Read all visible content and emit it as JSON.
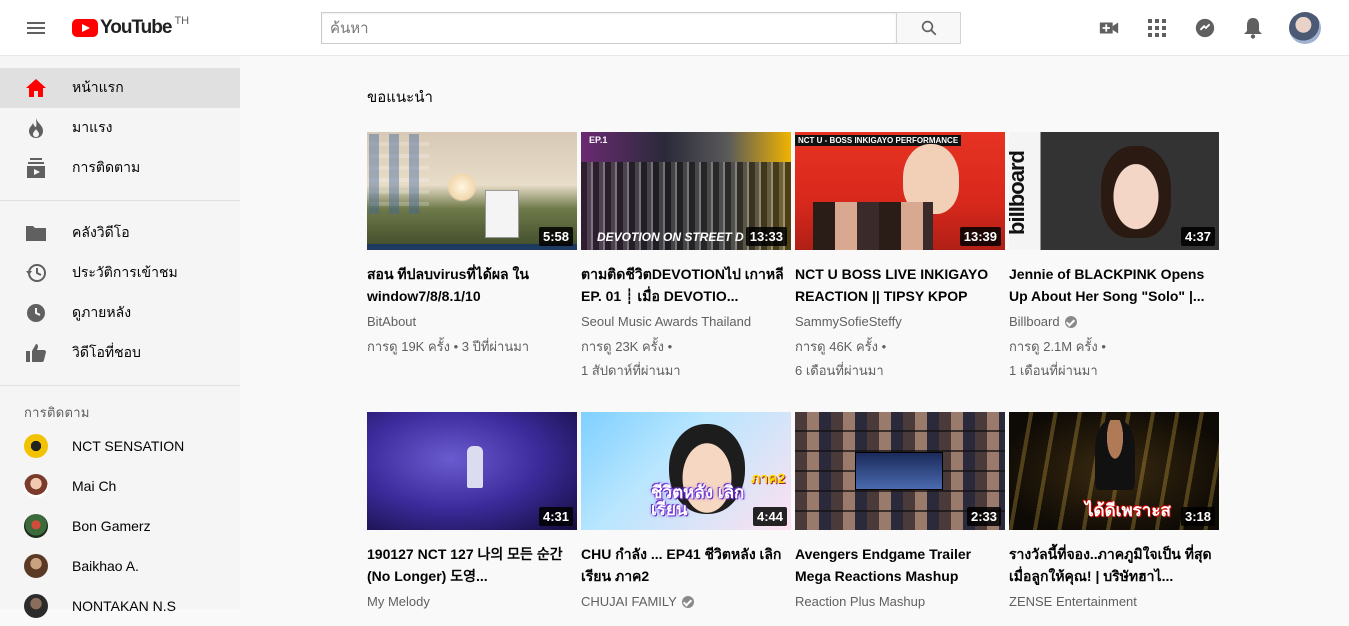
{
  "header": {
    "logo_text": "YouTube",
    "logo_country": "TH",
    "search_placeholder": "ค้นหา"
  },
  "sidebar": {
    "primary": [
      {
        "label": "หน้าแรก",
        "icon": "home-icon",
        "active": true
      },
      {
        "label": "มาแรง",
        "icon": "fire-icon",
        "active": false
      },
      {
        "label": "การติดตาม",
        "icon": "subscriptions-icon",
        "active": false
      }
    ],
    "library": [
      {
        "label": "คลังวิดีโอ",
        "icon": "folder-icon"
      },
      {
        "label": "ประวัติการเข้าชม",
        "icon": "history-icon"
      },
      {
        "label": "ดูภายหลัง",
        "icon": "clock-icon"
      },
      {
        "label": "วิดีโอที่ชอบ",
        "icon": "thumbs-up-icon"
      }
    ],
    "subscriptions_heading": "การติดตาม",
    "subscriptions": [
      {
        "label": "NCT SENSATION"
      },
      {
        "label": "Mai Ch"
      },
      {
        "label": "Bon Gamerz"
      },
      {
        "label": "Baikhao A."
      },
      {
        "label": "NONTAKAN N.S"
      }
    ]
  },
  "main": {
    "section_title": "ขอแนะนำ",
    "videos": [
      {
        "title": "สอน ทีปลบvirusที่ได้ผล ใน window7/8/8.1/10",
        "channel": "BitAbout",
        "verified": false,
        "views": "การดู 19K ครั้ง",
        "age": "3 ปีที่ผ่านมา",
        "duration": "5:58"
      },
      {
        "title": "ตามติดชีวิตDEVOTIONไป เกาหลี EP. 01 ┊ เมื่อ DEVOTIO...",
        "channel": "Seoul Music Awards Thailand",
        "verified": false,
        "views": "การดู 23K ครั้ง",
        "age": "1 สัปดาห์ที่ผ่านมา",
        "duration": "13:33",
        "thumb_text": "DEVOTION ON STREET D",
        "thumb_badge": "EP.1"
      },
      {
        "title": "NCT U BOSS LIVE INKIGAYO REACTION || TIPSY KPOP",
        "channel": "SammySofieSteffy",
        "verified": false,
        "views": "การดู 46K ครั้ง",
        "age": "6 เดือนที่ผ่านมา",
        "duration": "13:39",
        "thumb_text": "NCT U - BOSS INKIGAYO PERFORMANCE"
      },
      {
        "title": "Jennie of BLACKPINK Opens Up About Her Song \"Solo\" |...",
        "channel": "Billboard",
        "verified": true,
        "views": "การดู 2.1M ครั้ง",
        "age": "1 เดือนที่ผ่านมา",
        "duration": "4:37",
        "thumb_text": "billboard"
      },
      {
        "title": "190127 NCT 127 나의 모든 순간(No Longer) 도영...",
        "channel": "My Melody",
        "verified": false,
        "duration": "4:31"
      },
      {
        "title": "CHU กำลัง ... EP41 ชีวิตหลัง เลิกเรียน ภาค2",
        "channel": "CHUJAI FAMILY",
        "verified": true,
        "duration": "4:44",
        "thumb_text": "ชีวิตหลัง เลิกเรียน",
        "thumb_badge": "ภาค2"
      },
      {
        "title": "Avengers Endgame Trailer Mega Reactions Mashup",
        "channel": "Reaction Plus Mashup",
        "verified": false,
        "duration": "2:33"
      },
      {
        "title": "รางวัลนี้ที่จอง..ภาคภูมิใจเป็น ที่สุดเมื่อลูกให้คุณ! | บริษัทฮาไ...",
        "channel": "ZENSE Entertainment",
        "verified": false,
        "duration": "3:18",
        "thumb_text": "ได้ดีเพราะส"
      }
    ]
  },
  "colors": {
    "brand_red": "#ff0000",
    "sidebar_bg": "#f5f5f5",
    "active_bg": "#e0e0e0"
  }
}
